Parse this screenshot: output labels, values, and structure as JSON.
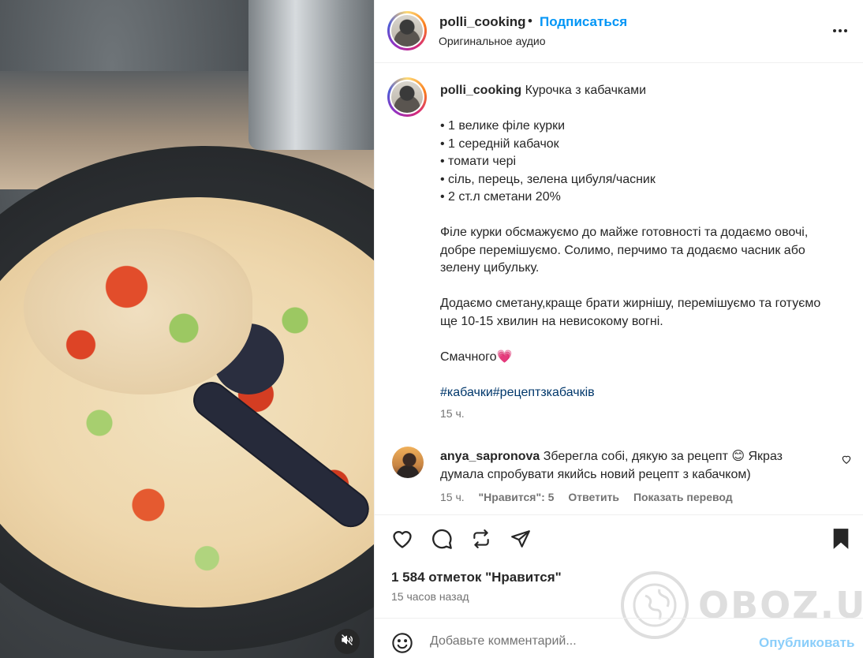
{
  "header": {
    "username": "polli_cooking",
    "separator": "•",
    "follow_label": "Подписаться",
    "audio_label": "Оригинальное аудио",
    "more_icon": "more-horizontal-icon"
  },
  "caption": {
    "username": "polli_cooking",
    "title": "Курочка з кабачками",
    "ingredients": [
      "• 1 велике філе курки",
      "• 1 середній кабачок",
      "• томати чері",
      "• сіль, перець, зелена цибуля/часник",
      "• 2 ст.л сметани 20%"
    ],
    "paragraph1": "Філе курки обсмажуємо до майже готовності та додаємо овочі, добре перемішуємо. Солимо, перчимо та додаємо часник або зелену цибульку.",
    "paragraph2": "Додаємо сметану,краще брати жирнішу, перемішуємо та готуємо ще 10-15 хвилин на невисокому вогні.",
    "closing": "Смачного",
    "closing_emoji": "💗",
    "hashtags": "#кабачки#рецептзкабачків",
    "time": "15 ч."
  },
  "comment": {
    "username": "anya_sapronova",
    "text_part1": "Зберегла собі, дякую за рецепт",
    "emoji": "😊",
    "text_part2": "Якраз думала спробувати якийсь новий рецепт з кабачком)",
    "time": "15 ч.",
    "likes_label": "\"Нравится\": 5",
    "reply_label": "Ответить",
    "translate_label": "Показать перевод"
  },
  "actions": {
    "like_icon": "heart-icon",
    "comment_icon": "comment-icon",
    "repost_icon": "repost-icon",
    "share_icon": "share-icon",
    "save_icon": "bookmark-icon"
  },
  "likes_text": "1 584 отметок \"Нравится\"",
  "posted_ago": "15 часов назад",
  "composer": {
    "placeholder": "Добавьте комментарий...",
    "publish_label": "Опубликовать"
  },
  "watermark": "OBOZ.UA",
  "colors": {
    "accent": "#0095f6",
    "hashtag": "#00376b",
    "secondary_text": "#737373",
    "primary_text": "#262626"
  }
}
